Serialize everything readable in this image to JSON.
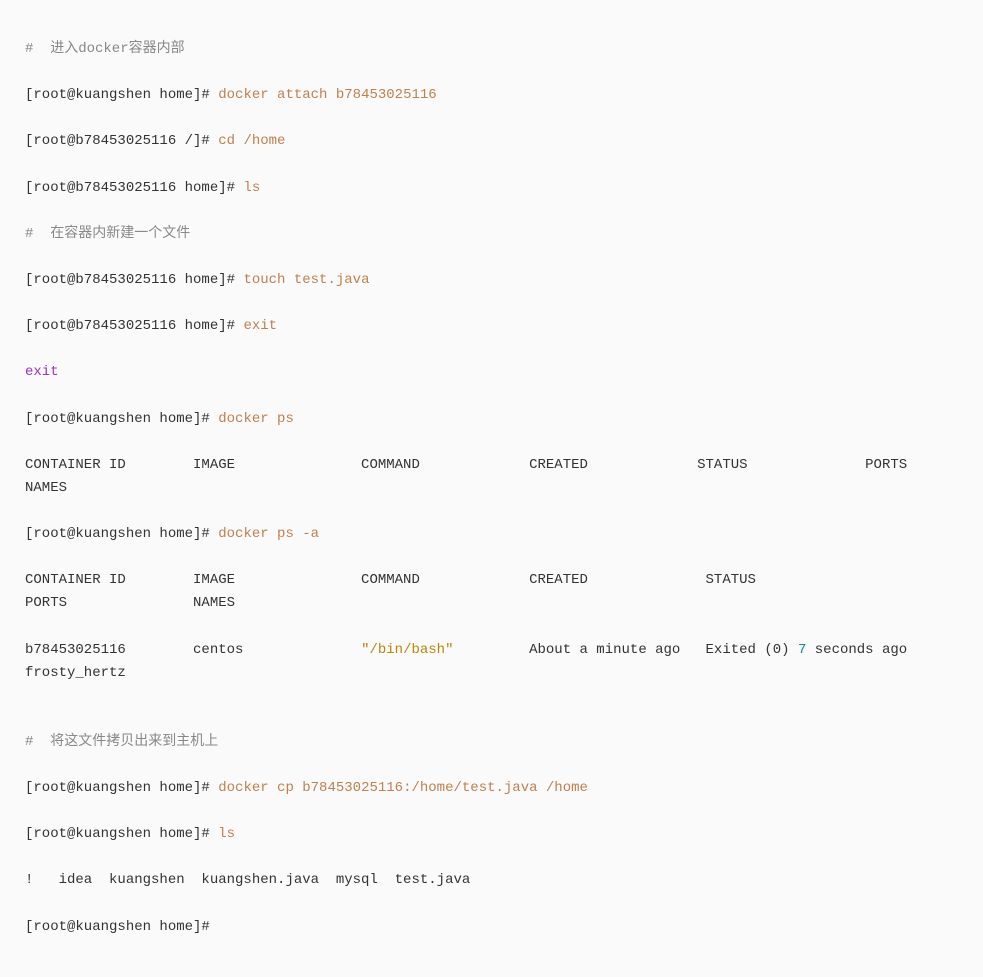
{
  "lines": {
    "l1_comment": "#  进入docker容器内部",
    "l2_prompt": "[root@kuangshen home]#",
    "l2_cmd": " docker attach b78453025116",
    "l3_prompt": "[root@b78453025116 /]#",
    "l3_cmd": " cd /home",
    "l4_prompt": "[root@b78453025116 home]#",
    "l4_cmd": " ls",
    "l5_comment": "#  在容器内新建一个文件",
    "l6_prompt": "[root@b78453025116 home]#",
    "l6_cmd": " touch test.java",
    "l7_prompt": "[root@b78453025116 home]#",
    "l7_cmd": " exit",
    "l8_exit": "exit",
    "l9_prompt": "[root@kuangshen home]#",
    "l9_cmd": " docker ps",
    "l10_header": "CONTAINER ID        IMAGE               COMMAND             CREATED             STATUS              PORTS               NAMES",
    "l11_prompt": "[root@kuangshen home]#",
    "l11_cmd": " docker ps -a",
    "l12_header": "CONTAINER ID        IMAGE               COMMAND             CREATED              STATUS                     PORTS               NAMES",
    "l13_p1": "b78453025116        centos              ",
    "l13_str": "\"/bin/bash\"",
    "l13_p2": "         About a minute ago   Exited (0) ",
    "l13_num": "7",
    "l13_p3": " seconds ago                       frosty_hertz",
    "l14_blank": "",
    "l15_comment": "#  将这文件拷贝出来到主机上",
    "l16_prompt": "[root@kuangshen home]#",
    "l16_cmd": " docker cp b78453025116:/home/test.java /home",
    "l17_prompt": "[root@kuangshen home]#",
    "l17_cmd": " ls",
    "l18_output": "!   idea  kuangshen  kuangshen.java  mysql  test.java",
    "l19_prompt": "[root@kuangshen home]#"
  }
}
